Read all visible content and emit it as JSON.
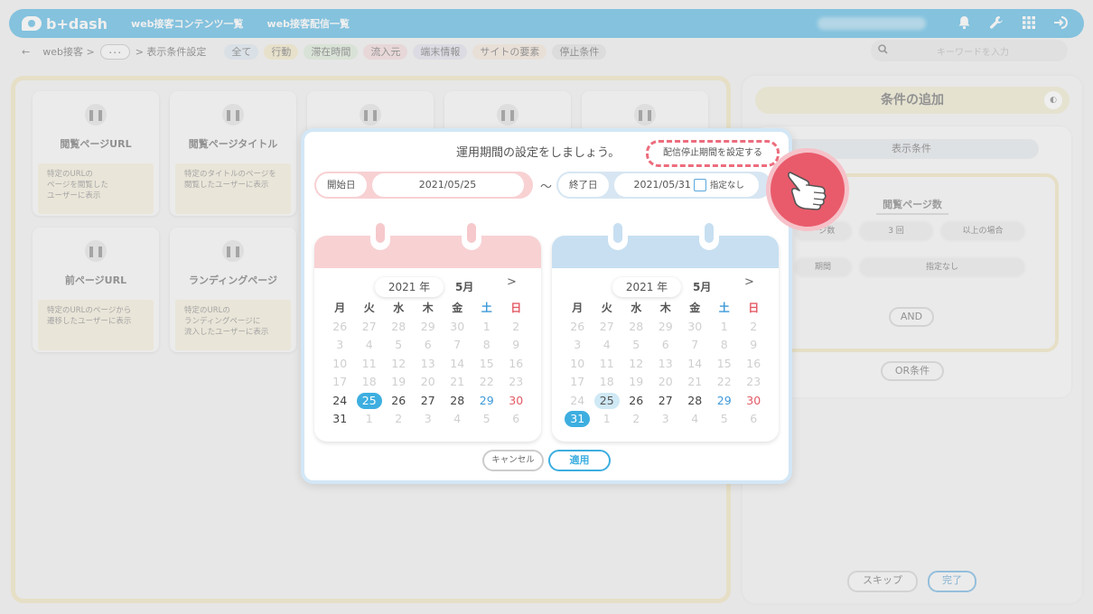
{
  "topbar": {
    "logo": "b+dash",
    "nav": [
      "web接客コンテンツ一覧",
      "web接客配信一覧"
    ]
  },
  "crumbs": {
    "back": "←",
    "root": "web接客 >",
    "dots": "･･･",
    "current": "> 表示条件設定"
  },
  "filter_tags": [
    {
      "label": "全て",
      "color": "#d8e4ee"
    },
    {
      "label": "行動",
      "color": "#f1e5bd"
    },
    {
      "label": "滞在時間",
      "color": "#d7e8d2"
    },
    {
      "label": "流入元",
      "color": "#f3d4d6"
    },
    {
      "label": "端末情報",
      "color": "#dcdbe9"
    },
    {
      "label": "サイトの要素",
      "color": "#f3e2d3"
    },
    {
      "label": "停止条件",
      "color": "#dcdcdc"
    }
  ],
  "search": {
    "placeholder": "キーワードを入力"
  },
  "cards": [
    {
      "title": "閲覧ページURL",
      "desc": "特定のURLの\nページを閲覧した\nユーザーに表示"
    },
    {
      "title": "閲覧ページタイトル",
      "desc": "特定のタイトルのページを\n閲覧したユーザーに表示"
    },
    {
      "title": "",
      "desc": ""
    },
    {
      "title": "",
      "desc": ""
    },
    {
      "title": "",
      "desc": ""
    },
    {
      "title": "前ページURL",
      "desc": "特定のURLのページから\n遷移したユーザーに表示"
    },
    {
      "title": "ランディングページ",
      "desc": "特定のURLの\nランディングページに\n流入したユーザーに表示"
    }
  ],
  "right": {
    "add_title": "条件の追加",
    "cond_header": "表示条件",
    "cond_title": "閲覧ページ数",
    "row1": [
      "ージ数",
      "3 回",
      "以上の場合"
    ],
    "row2": [
      "期間",
      "指定なし"
    ],
    "and": "AND",
    "or": "OR条件",
    "skip": "スキップ",
    "done": "完了"
  },
  "modal": {
    "title": "運用期間の設定をしましょう。",
    "stop_link": "配信停止期間を設定する",
    "start_label": "開始日",
    "start_value": "2021/05/25",
    "tilde": "～",
    "end_label": "終了日",
    "end_value": "2021/05/31",
    "no_spec": "指定なし",
    "cancel": "キャンセル",
    "apply": "適用"
  },
  "calendars": [
    {
      "year": "2021 年",
      "month": "5月",
      "next": ">",
      "head_color": "#f8d1d3",
      "ring_color": "#f6c9cc",
      "weekdays": [
        "月",
        "火",
        "水",
        "木",
        "金",
        "土",
        "日"
      ],
      "weeks": [
        [
          "26",
          "27",
          "28",
          "29",
          "30",
          "1",
          "2"
        ],
        [
          "3",
          "4",
          "5",
          "6",
          "7",
          "8",
          "9"
        ],
        [
          "10",
          "11",
          "12",
          "13",
          "14",
          "15",
          "16"
        ],
        [
          "17",
          "18",
          "19",
          "20",
          "21",
          "22",
          "23"
        ],
        [
          "24",
          "25",
          "26",
          "27",
          "28",
          "29",
          "30"
        ],
        [
          "31",
          "1",
          "2",
          "3",
          "4",
          "5",
          "6"
        ]
      ],
      "selected": "25"
    },
    {
      "year": "2021 年",
      "month": "5月",
      "next": ">",
      "head_color": "#c7dff1",
      "ring_color": "#c7dff1",
      "weekdays": [
        "月",
        "火",
        "水",
        "木",
        "金",
        "土",
        "日"
      ],
      "weeks": [
        [
          "26",
          "27",
          "28",
          "29",
          "30",
          "1",
          "2"
        ],
        [
          "3",
          "4",
          "5",
          "6",
          "7",
          "8",
          "9"
        ],
        [
          "10",
          "11",
          "12",
          "13",
          "14",
          "15",
          "16"
        ],
        [
          "17",
          "18",
          "19",
          "20",
          "21",
          "22",
          "23"
        ],
        [
          "24",
          "25",
          "26",
          "27",
          "28",
          "29",
          "30"
        ],
        [
          "31",
          "1",
          "2",
          "3",
          "4",
          "5",
          "6"
        ]
      ],
      "selected": "31",
      "range_start": "25"
    }
  ]
}
